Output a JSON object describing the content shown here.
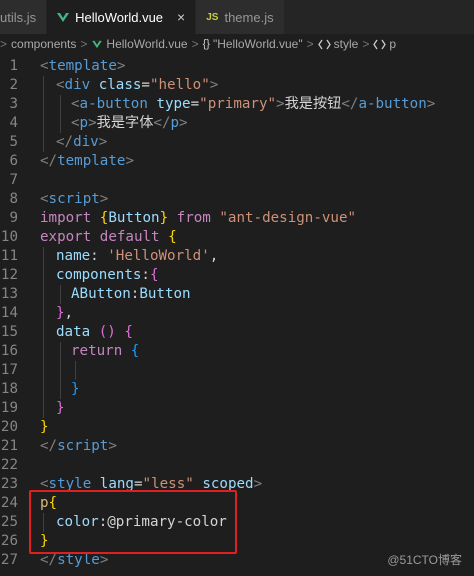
{
  "tabs": [
    {
      "label": "utils.js",
      "icon": "js-icon",
      "active": false
    },
    {
      "label": "HelloWorld.vue",
      "icon": "vue-icon",
      "active": true
    },
    {
      "label": "theme.js",
      "icon": "js-icon",
      "active": false
    }
  ],
  "tab_icons": {
    "js": "JS",
    "close": "×"
  },
  "breadcrumb": {
    "items": [
      "components",
      "HelloWorld.vue",
      "\"HelloWorld.vue\"",
      "style",
      "p"
    ],
    "separator": ">",
    "braces": "{}"
  },
  "code": {
    "l1_open": "<",
    "l1_tag": "template",
    "l1_close": ">",
    "l2_open": "<",
    "l2_tag": "div",
    "l2_attr": " class",
    "l2_eq": "=",
    "l2_val": "\"hello\"",
    "l2_close": ">",
    "l3_open": "<",
    "l3_tag": "a-button",
    "l3_attr": " type",
    "l3_eq": "=",
    "l3_val": "\"primary\"",
    "l3_close": ">",
    "l3_text": "我是按钮",
    "l3_end_open": "</",
    "l3_end_tag": "a-button",
    "l3_end_close": ">",
    "l4_open": "<",
    "l4_tag": "p",
    "l4_close": ">",
    "l4_text": "我是字体",
    "l4_end_open": "</",
    "l4_end_tag": "p",
    "l4_end_close": ">",
    "l5_open": "</",
    "l5_tag": "div",
    "l5_close": ">",
    "l6_open": "</",
    "l6_tag": "template",
    "l6_close": ">",
    "l8_open": "<",
    "l8_tag": "script",
    "l8_close": ">",
    "l9_kw": "import ",
    "l9_b1": "{",
    "l9_name": "Button",
    "l9_b2": "}",
    "l9_from": " from ",
    "l9_str": "\"ant-design-vue\"",
    "l10_kw": "export ",
    "l10_kw2": "default ",
    "l10_b": "{",
    "l11_prop": "name",
    "l11_colon": ": ",
    "l11_str": "'HelloWorld'",
    "l11_comma": ",",
    "l12_prop": "components",
    "l12_colon": ":",
    "l12_b": "{",
    "l13_prop": "AButton",
    "l13_colon": ":",
    "l13_val": "Button",
    "l14_b": "}",
    "l14_comma": ",",
    "l15_fn": "data ",
    "l15_paren": "()",
    "l15_sp": " ",
    "l15_b": "{",
    "l16_kw": "return ",
    "l16_b": "{",
    "l18_b": "}",
    "l19_b": "}",
    "l20_b": "}",
    "l21_open": "</",
    "l21_tag": "script",
    "l21_close": ">",
    "l23_open": "<",
    "l23_tag": "style",
    "l23_attr1": " lang",
    "l23_eq1": "=",
    "l23_val1": "\"less\"",
    "l23_attr2": " scoped",
    "l23_close": ">",
    "l24_sel": "p",
    "l24_b": "{",
    "l25_prop": "color",
    "l25_colon": ":",
    "l25_val": "@primary-color",
    "l26_b": "}",
    "l27_open": "</",
    "l27_tag": "style",
    "l27_close": ">"
  },
  "line_numbers": [
    "1",
    "2",
    "3",
    "4",
    "5",
    "6",
    "7",
    "8",
    "9",
    "10",
    "11",
    "12",
    "13",
    "14",
    "15",
    "16",
    "17",
    "18",
    "19",
    "20",
    "21",
    "22",
    "23",
    "24",
    "25",
    "26",
    "27"
  ],
  "watermark": "@51CTO博客",
  "colors": {
    "background": "#1e1e1e",
    "tag": "#569cd6",
    "string": "#ce9178",
    "attribute": "#9cdcfe",
    "keyword": "#c586c0",
    "highlight_box": "#e02020"
  }
}
